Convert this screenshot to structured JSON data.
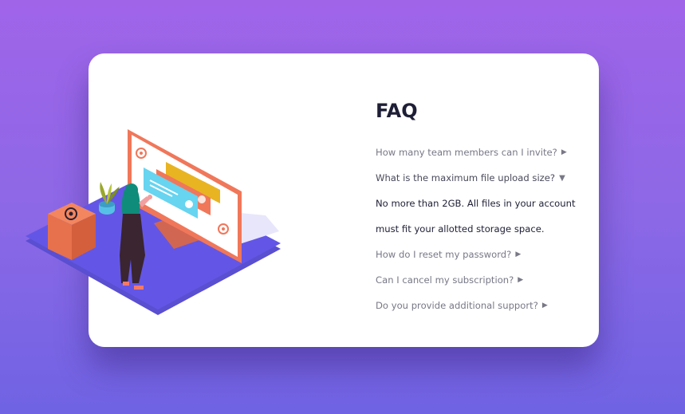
{
  "faq": {
    "title": "FAQ",
    "items": [
      {
        "question": "How many team members can I invite?",
        "arrow": "▶",
        "open": false
      },
      {
        "question": "What is the maximum file upload size?",
        "arrow": "▼",
        "open": true,
        "answer_line1": "No more than 2GB. All files in your account",
        "answer_line2": "must fit your allotted storage space."
      },
      {
        "question": "How do I reset my password?",
        "arrow": "▶",
        "open": false
      },
      {
        "question": "Can I cancel my subscription?",
        "arrow": "▶",
        "open": false
      },
      {
        "question": "Do you provide additional support?",
        "arrow": "▶",
        "open": false
      }
    ]
  },
  "colors": {
    "background_top": "#a064e9",
    "background_bottom": "#6f63e3",
    "title": "#1e1f36",
    "question": "#787887",
    "answer": "#1e1f36"
  },
  "illustration": {
    "icons": [
      "at-sign-icon",
      "at-sign-icon",
      "at-sign-icon"
    ]
  }
}
